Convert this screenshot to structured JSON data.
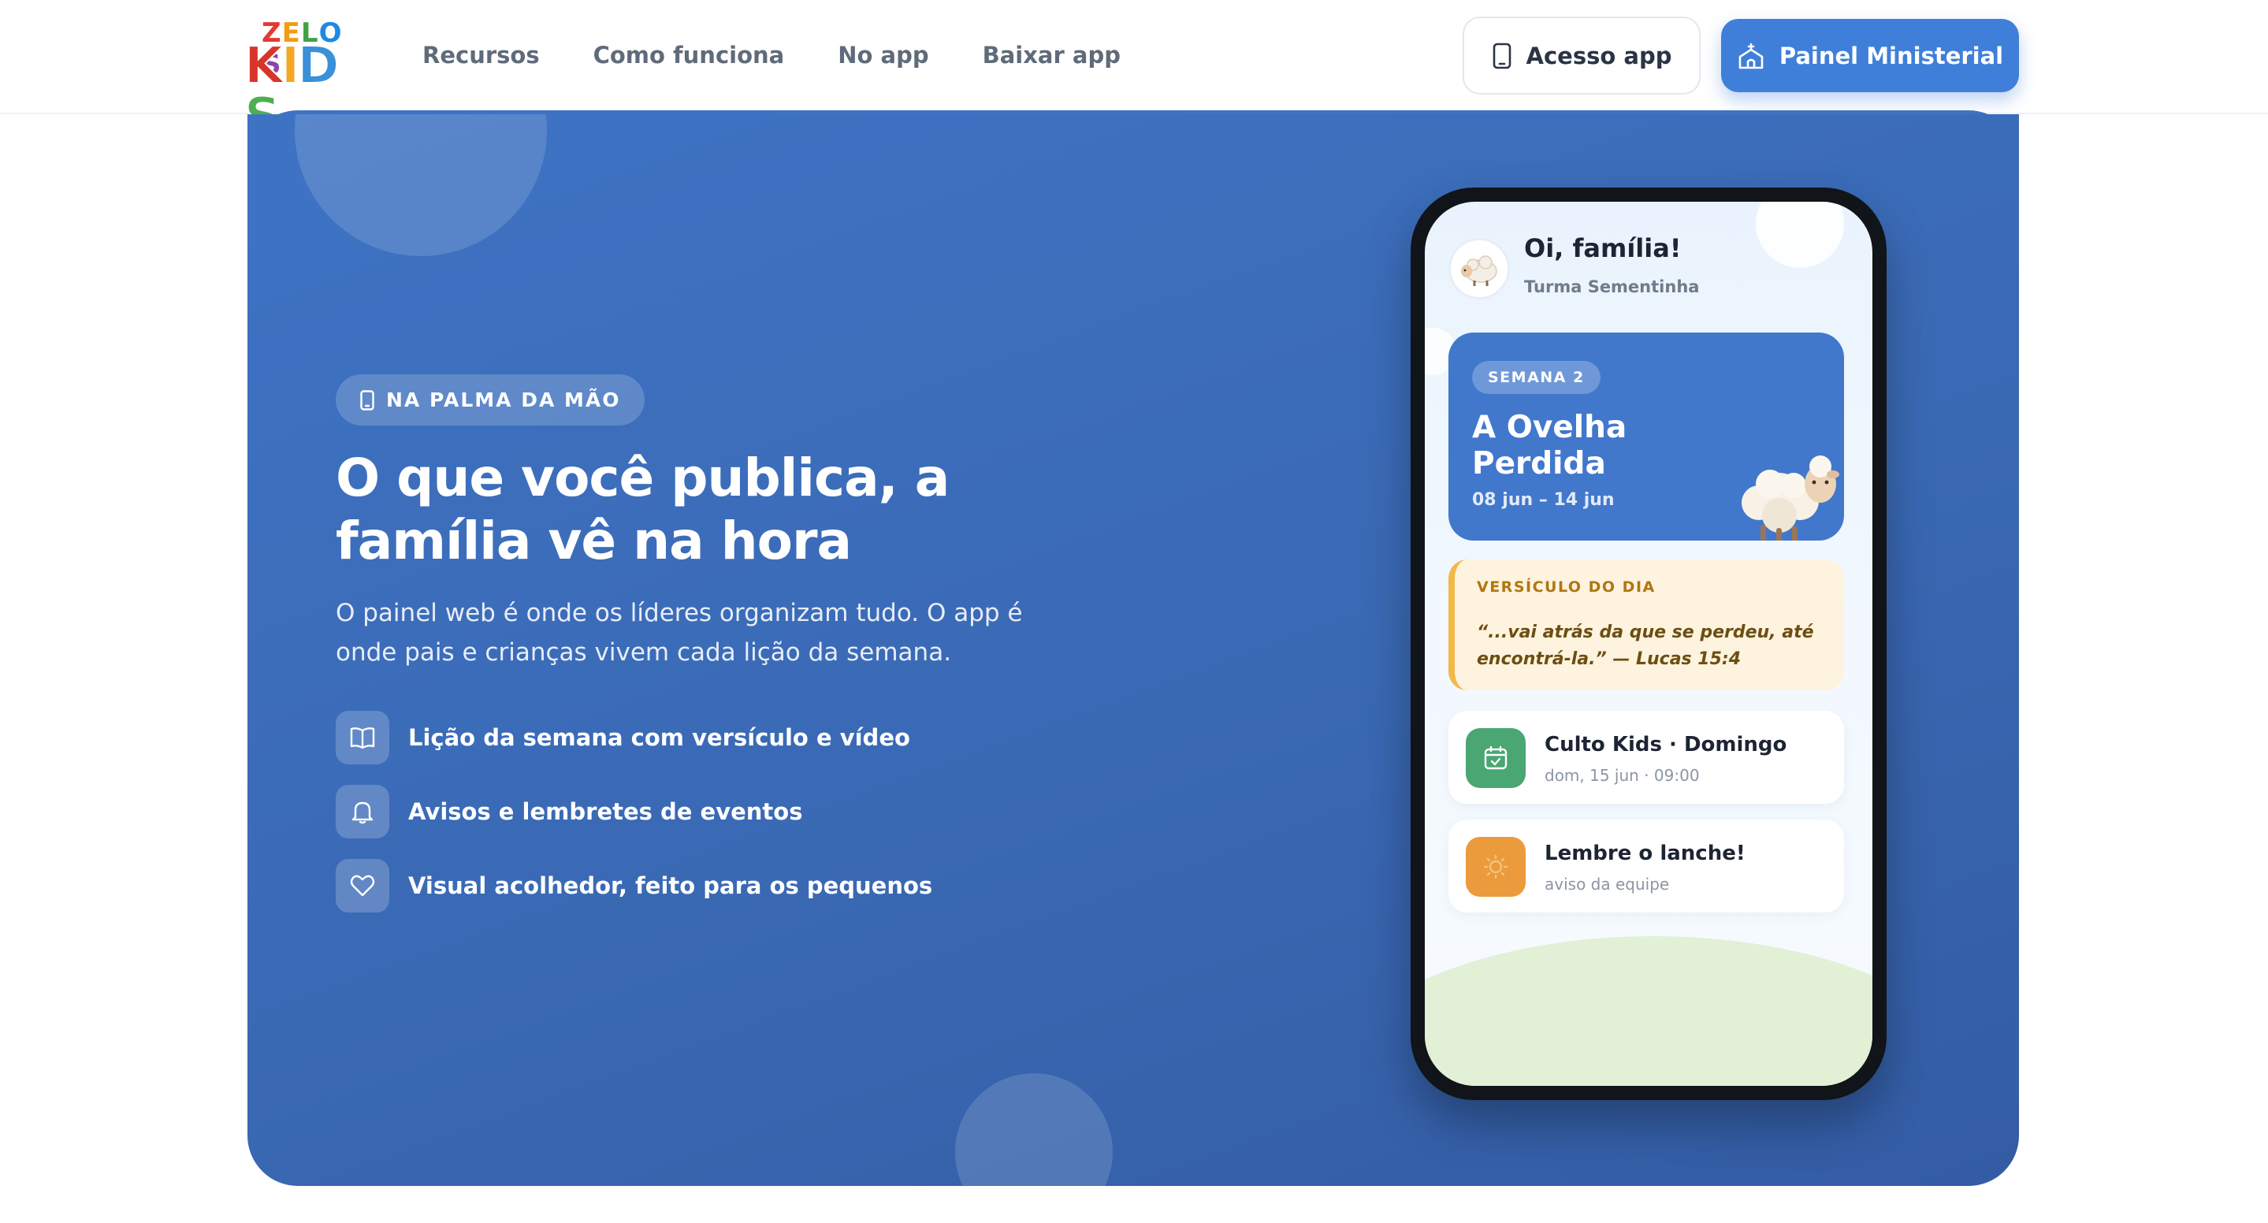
{
  "header": {
    "logo": {
      "top": "ZELOS",
      "bottom": "KIDS"
    },
    "nav": [
      "Recursos",
      "Como funciona",
      "No app",
      "Baixar app"
    ],
    "access_label": "Acesso app",
    "panel_label": "Painel Ministerial"
  },
  "hero": {
    "pill": "NA PALMA DA MÃO",
    "title": "O que você publica, a família vê na hora",
    "subtitle": "O painel web é onde os líderes organizam tudo. O app é onde pais e crianças vivem cada lição da semana.",
    "features": [
      {
        "icon": "book-icon",
        "text": "Lição da semana com versículo e vídeo"
      },
      {
        "icon": "bell-icon",
        "text": "Avisos e lembretes de eventos"
      },
      {
        "icon": "heart-icon",
        "text": "Visual acolhedor, feito para os pequenos"
      }
    ]
  },
  "phone": {
    "greeting": "Oi, família!",
    "class_name": "Turma Sementinha",
    "lesson": {
      "badge": "SEMANA 2",
      "title": "A Ovelha Perdida",
      "dates": "08 jun – 14 jun"
    },
    "verse": {
      "label": "VERSÍCULO DO DIA",
      "text": "“...vai atrás da que se perdeu, até encontrá-la.” — Lucas 15:4"
    },
    "cards": [
      {
        "icon": "calendar-icon",
        "title": "Culto Kids · Domingo",
        "subtitle": "dom, 15 jun · 09:00"
      },
      {
        "icon": "sun-icon",
        "title": "Lembre o lanche!",
        "subtitle": "aviso da equipe"
      }
    ]
  },
  "colors": {
    "primary": "#3f7fd9",
    "hero_bg": "#3a69b4",
    "green": "#4aa672",
    "orange": "#eb9a3c",
    "verse_accent": "#f2b84a"
  }
}
